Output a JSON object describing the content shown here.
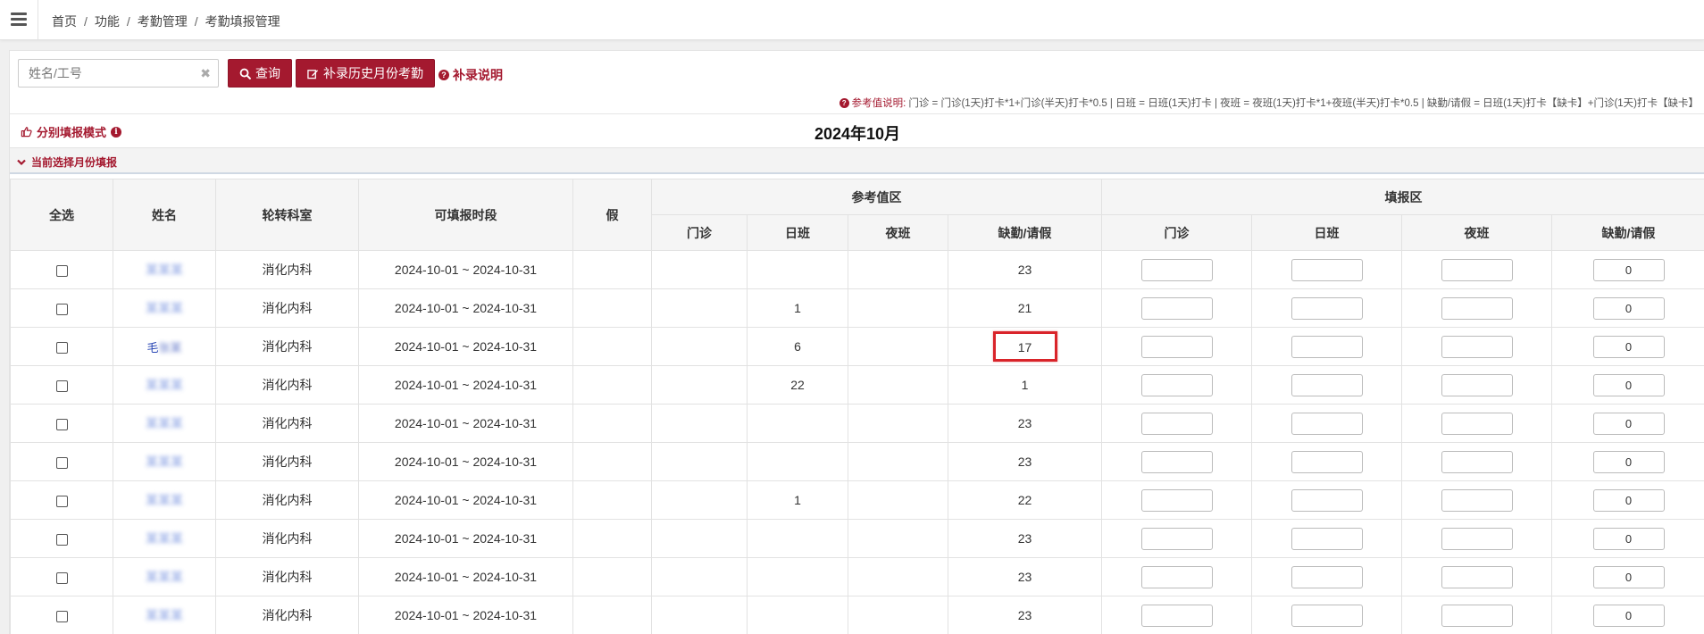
{
  "breadcrumb": [
    "首页",
    "功能",
    "考勤管理",
    "考勤填报管理"
  ],
  "search": {
    "placeholder": "姓名/工号",
    "value": ""
  },
  "buttons": {
    "query": "查询",
    "supplement": "补录历史月份考勤",
    "help": "补录说明"
  },
  "reference_note": {
    "title": "参考值说明:",
    "text": "门诊 = 门诊(1天)打卡*1+门诊(半天)打卡*0.5 | 日班 = 日班(1天)打卡 | 夜班 = 夜班(1天)打卡*1+夜班(半天)打卡*0.5 | 缺勤/请假 = 日班(1天)打卡【缺卡】+门诊(1天)打卡【缺卡】"
  },
  "mode_label": "分别填报模式",
  "month_title": "2024年10月",
  "section_label": "当前选择月份填报",
  "table": {
    "headers": {
      "select_all": "全选",
      "name": "姓名",
      "dept": "轮转科室",
      "period": "可填报时段",
      "leave": "假",
      "ref_group": "参考值区",
      "fill_group": "填报区",
      "clinic": "门诊",
      "day": "日班",
      "night": "夜班",
      "absence": "缺勤/请假"
    },
    "rows": [
      {
        "name": "",
        "dept": "消化内科",
        "period": "2024-10-01 ~ 2024-10-31",
        "leave": "",
        "ref_clinic": "",
        "ref_day": "",
        "ref_night": "",
        "ref_absence": "23",
        "fill_clinic": "",
        "fill_day": "",
        "fill_night": "",
        "fill_absence": "0"
      },
      {
        "name": "",
        "dept": "消化内科",
        "period": "2024-10-01 ~ 2024-10-31",
        "leave": "",
        "ref_clinic": "",
        "ref_day": "1",
        "ref_night": "",
        "ref_absence": "21",
        "fill_clinic": "",
        "fill_day": "",
        "fill_night": "",
        "fill_absence": "0"
      },
      {
        "name": "毛",
        "dept": "消化内科",
        "period": "2024-10-01 ~ 2024-10-31",
        "leave": "",
        "ref_clinic": "",
        "ref_day": "6",
        "ref_night": "",
        "ref_absence": "17",
        "fill_clinic": "",
        "fill_day": "",
        "fill_night": "",
        "fill_absence": "0"
      },
      {
        "name": "",
        "dept": "消化内科",
        "period": "2024-10-01 ~ 2024-10-31",
        "leave": "",
        "ref_clinic": "",
        "ref_day": "22",
        "ref_night": "",
        "ref_absence": "1",
        "fill_clinic": "",
        "fill_day": "",
        "fill_night": "",
        "fill_absence": "0"
      },
      {
        "name": "",
        "dept": "消化内科",
        "period": "2024-10-01 ~ 2024-10-31",
        "leave": "",
        "ref_clinic": "",
        "ref_day": "",
        "ref_night": "",
        "ref_absence": "23",
        "fill_clinic": "",
        "fill_day": "",
        "fill_night": "",
        "fill_absence": "0"
      },
      {
        "name": "",
        "dept": "消化内科",
        "period": "2024-10-01 ~ 2024-10-31",
        "leave": "",
        "ref_clinic": "",
        "ref_day": "",
        "ref_night": "",
        "ref_absence": "23",
        "fill_clinic": "",
        "fill_day": "",
        "fill_night": "",
        "fill_absence": "0"
      },
      {
        "name": "",
        "dept": "消化内科",
        "period": "2024-10-01 ~ 2024-10-31",
        "leave": "",
        "ref_clinic": "",
        "ref_day": "1",
        "ref_night": "",
        "ref_absence": "22",
        "fill_clinic": "",
        "fill_day": "",
        "fill_night": "",
        "fill_absence": "0"
      },
      {
        "name": "",
        "dept": "消化内科",
        "period": "2024-10-01 ~ 2024-10-31",
        "leave": "",
        "ref_clinic": "",
        "ref_day": "",
        "ref_night": "",
        "ref_absence": "23",
        "fill_clinic": "",
        "fill_day": "",
        "fill_night": "",
        "fill_absence": "0"
      },
      {
        "name": "",
        "dept": "消化内科",
        "period": "2024-10-01 ~ 2024-10-31",
        "leave": "",
        "ref_clinic": "",
        "ref_day": "",
        "ref_night": "",
        "ref_absence": "23",
        "fill_clinic": "",
        "fill_day": "",
        "fill_night": "",
        "fill_absence": "0"
      },
      {
        "name": "",
        "dept": "消化内科",
        "period": "2024-10-01 ~ 2024-10-31",
        "leave": "",
        "ref_clinic": "",
        "ref_day": "",
        "ref_night": "",
        "ref_absence": "23",
        "fill_clinic": "",
        "fill_day": "",
        "fill_night": "",
        "fill_absence": "0"
      }
    ]
  },
  "highlight_color": "#d9242a",
  "accent_color": "#a4192f"
}
